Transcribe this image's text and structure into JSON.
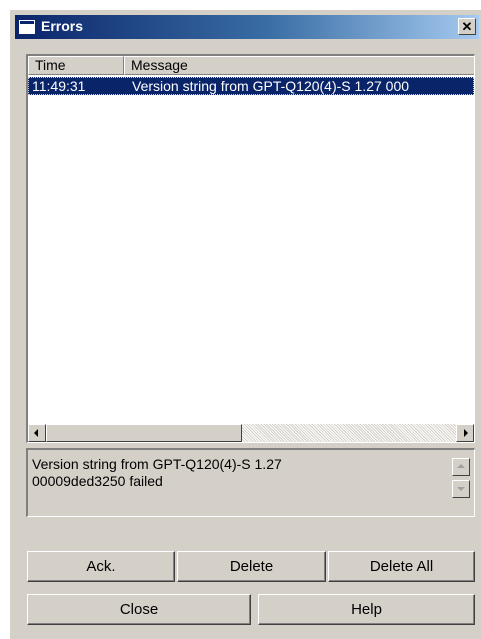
{
  "window": {
    "title": "Errors"
  },
  "list": {
    "columns": [
      "Time",
      "Message"
    ],
    "rows": [
      {
        "time": "11:49:31",
        "message": "Version string from GPT-Q120(4)-S 1.27 000"
      }
    ]
  },
  "detail": {
    "text": "Version string from GPT-Q120(4)-S 1.27\n00009ded3250 failed"
  },
  "buttons": {
    "ack": "Ack.",
    "delete": "Delete",
    "delete_all": "Delete All",
    "close": "Close",
    "help": "Help"
  },
  "colors": {
    "title_start": "#0a246a",
    "title_end": "#a6caf0",
    "selection": "#0a246a",
    "face": "#d4d0c8"
  },
  "icons": {
    "close": "close-icon",
    "window": "window-icon"
  }
}
